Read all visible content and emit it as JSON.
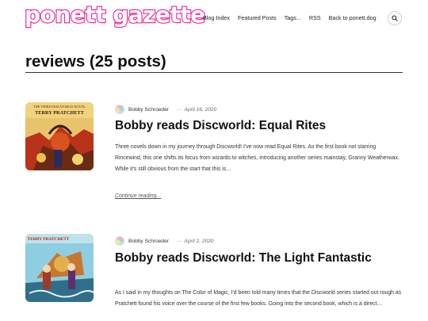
{
  "site": {
    "logo_text": "ponett gazette"
  },
  "nav": {
    "items": [
      "Blog Index",
      "Featured Posts",
      "Tags...",
      "RSS",
      "Back to ponett.dog"
    ]
  },
  "archive": {
    "title": "reviews (25 posts)"
  },
  "posts": [
    {
      "author": "Bobby Schroeder",
      "date": "April 16, 2020",
      "title": "Bobby reads Discworld: Equal Rites",
      "excerpt": "Three novels down in my journey through Discworld! I've now read Equal Rites. As the first book not starring Rincewind, this one shifts its focus from wizards to witches, introducing another series mainstay, Granny Weatherwax. While it's still obvious from the start that this is…",
      "more": "Continue reading...",
      "cover_top": "THE THIRD DISCWORLD NOVEL",
      "cover_author": "TERRY PRATCHETT"
    },
    {
      "author": "Bobby Schroeder",
      "date": "April 2, 2020",
      "title": "Bobby reads Discworld: The Light Fantastic",
      "excerpt": "As I said in my thoughts on The Color of Magic, I'd been told many times that the Discworld series started out rough as Pratchett found his voice over the course of the first few books. Going into the second book, which is a direct…",
      "cover_author": "TERRY PRATCHETT"
    }
  ],
  "colors": {
    "logo": "#ec2f9e",
    "rule": "#333333"
  }
}
